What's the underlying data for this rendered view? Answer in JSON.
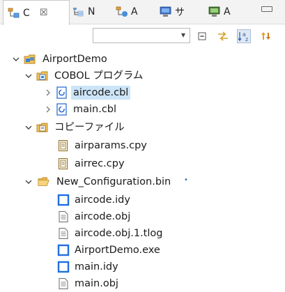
{
  "tabs": [
    {
      "label": "C",
      "active": true,
      "close": "☒"
    },
    {
      "label": "N",
      "active": false
    },
    {
      "label": "A",
      "active": false
    },
    {
      "label": "サ",
      "active": false
    },
    {
      "label": "A",
      "active": false
    }
  ],
  "toolbar": {
    "filter_value": "",
    "dropdown_glyph": "▾"
  },
  "tree": [
    {
      "label": "AirportDemo",
      "expanded": true,
      "icon": "project-icon"
    },
    {
      "label": "COBOL プログラム",
      "expanded": true,
      "icon": "cobol-folder-icon"
    },
    {
      "label": "aircode.cbl",
      "expanded": false,
      "icon": "cobol-file-icon",
      "selected": true
    },
    {
      "label": "main.cbl",
      "expanded": false,
      "icon": "cobol-file-icon"
    },
    {
      "label": "コピーファイル",
      "expanded": true,
      "icon": "copybook-folder-icon"
    },
    {
      "label": "airparams.cpy",
      "icon": "copybook-file-icon"
    },
    {
      "label": "airrec.cpy",
      "icon": "copybook-file-icon"
    },
    {
      "label": "New_Configuration.bin",
      "expanded": true,
      "icon": "open-folder-icon"
    },
    {
      "label": "aircode.idy",
      "icon": "idy-file-icon"
    },
    {
      "label": "aircode.obj",
      "icon": "text-file-icon"
    },
    {
      "label": "aircode.obj.1.tlog",
      "icon": "text-file-icon"
    },
    {
      "label": "AirportDemo.exe",
      "icon": "exe-file-icon"
    },
    {
      "label": "main.idy",
      "icon": "idy-file-icon"
    },
    {
      "label": "main.obj",
      "icon": "text-file-icon"
    }
  ]
}
